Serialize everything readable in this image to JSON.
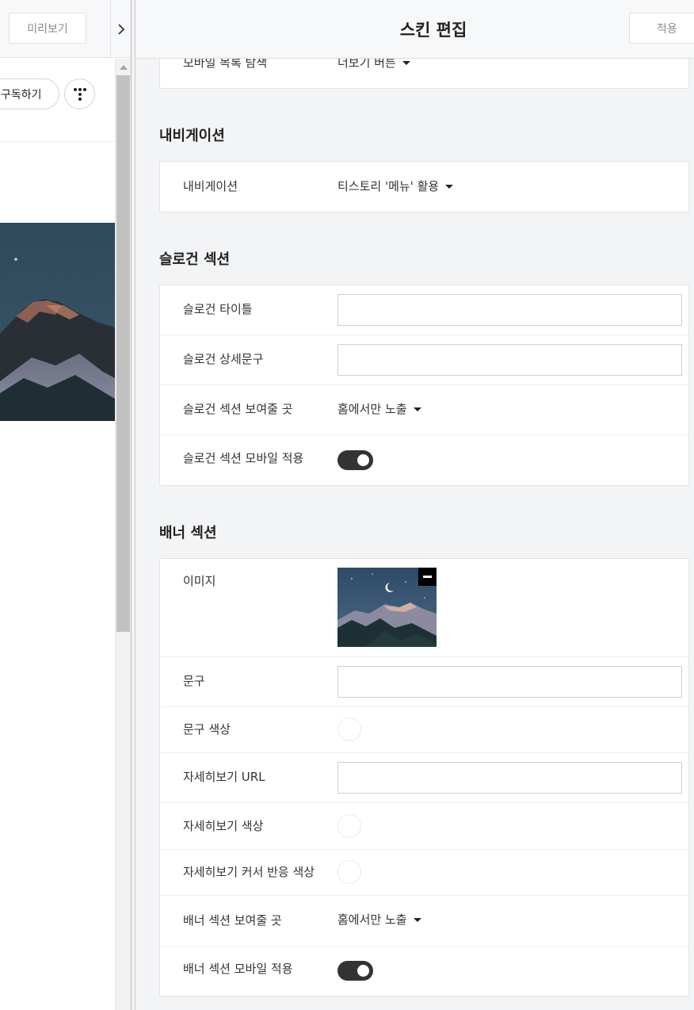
{
  "preview": {
    "preview_button": "미리보기",
    "subscribe_button": "구독하기"
  },
  "editor": {
    "title": "스킨 편집",
    "apply_button": "적용"
  },
  "top_partial_row": {
    "label": "모바일 목록 탐색",
    "value": "더보기 버튼"
  },
  "navigation_section": {
    "heading": "내비게이션",
    "rows": [
      {
        "label": "내비게이션",
        "value": "티스토리 '메뉴' 활용"
      }
    ]
  },
  "slogan_section": {
    "heading": "슬로건 섹션",
    "title_label": "슬로건 타이틀",
    "title_value": "",
    "detail_label": "슬로건 상세문구",
    "detail_value": "",
    "where_label": "슬로건 섹션 보여줄 곳",
    "where_value": "홈에서만 노출",
    "mobile_label": "슬로건 섹션 모바일 적용",
    "mobile_enabled": true
  },
  "banner_section": {
    "heading": "배너 섹션",
    "image_label": "이미지",
    "text_label": "문구",
    "text_value": "",
    "text_color_label": "문구 색상",
    "text_color": "#ffffff",
    "link_url_label": "자세히보기 URL",
    "link_url_value": "",
    "link_color_label": "자세히보기 색상",
    "link_color": "#ffffff",
    "hover_color_label": "자세히보기 커서 반응 색상",
    "hover_color": "#ffffff",
    "where_label": "배너 섹션 보여줄 곳",
    "where_value": "홈에서만 노출",
    "mobile_label": "배너 섹션 모바일 적용",
    "mobile_enabled": true
  },
  "colors": {
    "page_background": "#f3f4f6",
    "toggle_on": "#333333",
    "header_background": "#f7f8fa"
  },
  "icons": {
    "collapse_handle": "chevron-right-icon",
    "more_button": "tistory-dots-icon",
    "remove_image": "minus-icon"
  }
}
